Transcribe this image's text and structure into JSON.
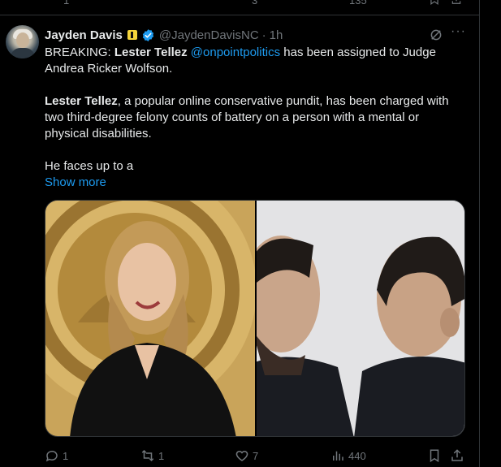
{
  "previous_tweet": {
    "counts": [
      "1",
      "3",
      "135"
    ]
  },
  "tweet": {
    "author_name": "Jayden Davis",
    "handle": "@JaydenDavisNC",
    "separator": "·",
    "time": "1h",
    "more_label": "···",
    "lines": {
      "breaking_prefix": "BREAKING: ",
      "subject": "Lester Tellez",
      "space": " ",
      "mention": "@onpointpolitics",
      "line1_rest": " has been assigned to Judge Andrea Ricker Wolfson.",
      "subject2": "Lester Tellez",
      "line2_rest": ", a popular online conservative pundit, has been charged with two third-degree felony counts of battery on a person with a mental or physical disabilities.",
      "line3": "He faces up to a"
    },
    "show_more": "Show more",
    "actions": {
      "replies": "1",
      "reposts": "1",
      "likes": "7",
      "views": "440"
    }
  },
  "colors": {
    "background": "#000000",
    "text": "#e7e9ea",
    "muted": "#71767b",
    "link": "#1d9bf0",
    "border": "#2f3336",
    "verified": "#1d9bf0"
  },
  "icons": [
    "reply-icon",
    "repost-icon",
    "like-icon",
    "views-icon",
    "bookmark-icon",
    "share-icon",
    "grok-icon",
    "more-icon",
    "verified-badge-icon",
    "affiliate-badge-icon"
  ]
}
